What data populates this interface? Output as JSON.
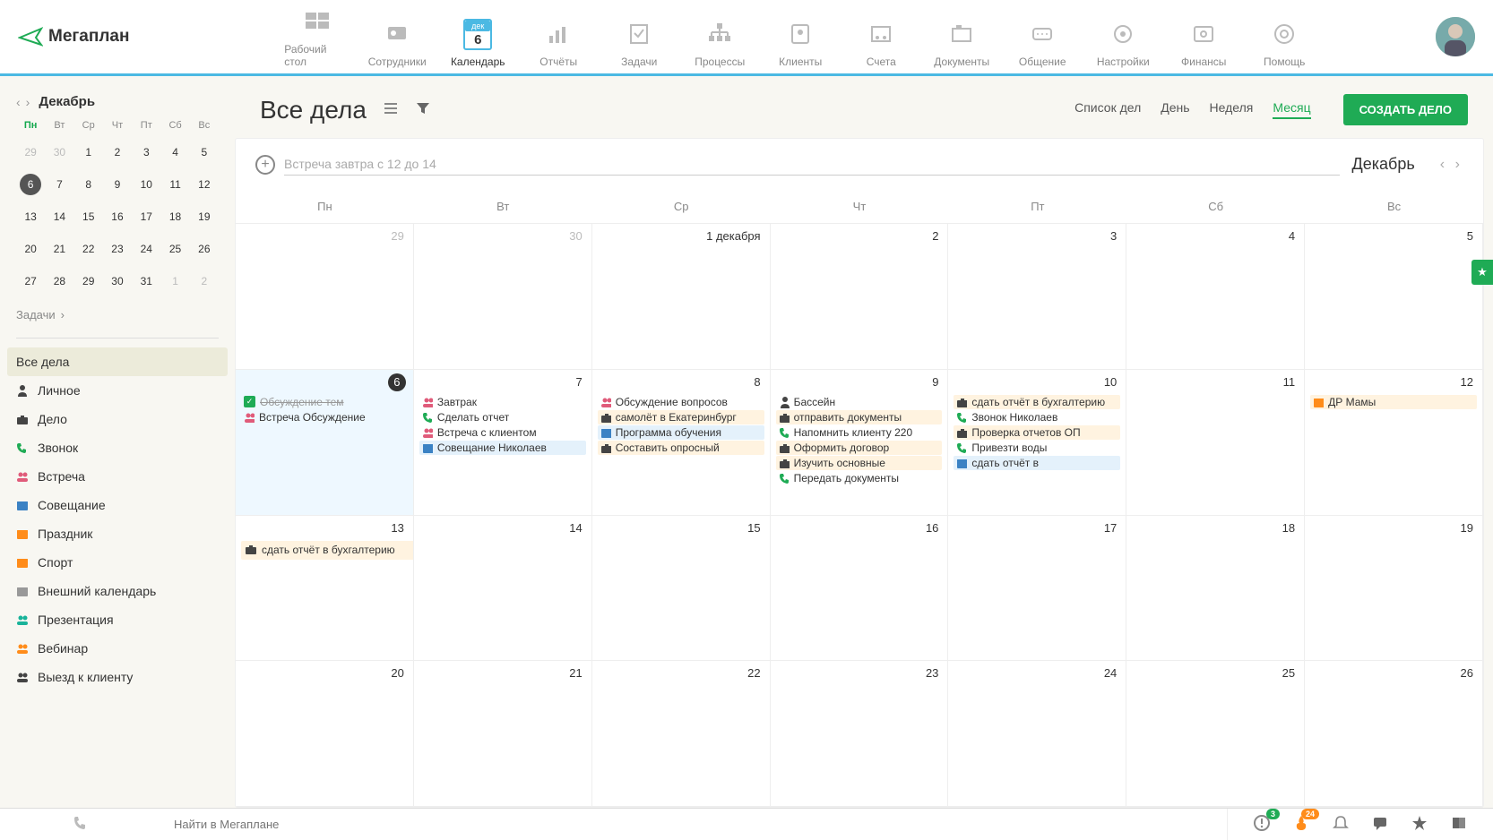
{
  "brand": "егаплан",
  "nav": [
    {
      "label": "Рабочий стол"
    },
    {
      "label": "Сотрудники"
    },
    {
      "label": "Календарь",
      "active": true,
      "badge": "дек",
      "num": "6"
    },
    {
      "label": "Отчёты"
    },
    {
      "label": "Задачи"
    },
    {
      "label": "Процессы"
    },
    {
      "label": "Клиенты"
    },
    {
      "label": "Счета"
    },
    {
      "label": "Документы"
    },
    {
      "label": "Общение"
    },
    {
      "label": "Настройки"
    },
    {
      "label": "Финансы"
    },
    {
      "label": "Помощь"
    }
  ],
  "sidebar": {
    "month": "Декабрь",
    "dow": [
      "Пн",
      "Вт",
      "Ср",
      "Чт",
      "Пт",
      "Сб",
      "Вс"
    ],
    "days": [
      {
        "n": "29",
        "m": true
      },
      {
        "n": "30",
        "m": true
      },
      {
        "n": "1"
      },
      {
        "n": "2"
      },
      {
        "n": "3"
      },
      {
        "n": "4"
      },
      {
        "n": "5"
      },
      {
        "n": "6",
        "sel": true
      },
      {
        "n": "7"
      },
      {
        "n": "8"
      },
      {
        "n": "9"
      },
      {
        "n": "10"
      },
      {
        "n": "11"
      },
      {
        "n": "12"
      },
      {
        "n": "13"
      },
      {
        "n": "14"
      },
      {
        "n": "15"
      },
      {
        "n": "16"
      },
      {
        "n": "17"
      },
      {
        "n": "18"
      },
      {
        "n": "19"
      },
      {
        "n": "20"
      },
      {
        "n": "21"
      },
      {
        "n": "22"
      },
      {
        "n": "23"
      },
      {
        "n": "24"
      },
      {
        "n": "25"
      },
      {
        "n": "26"
      },
      {
        "n": "27"
      },
      {
        "n": "28"
      },
      {
        "n": "29"
      },
      {
        "n": "30"
      },
      {
        "n": "31"
      },
      {
        "n": "1",
        "m": true
      },
      {
        "n": "2",
        "m": true
      }
    ],
    "tasks_label": "Задачи",
    "categories": [
      {
        "label": "Все дела",
        "sel": true
      },
      {
        "label": "Личное",
        "icon": "person",
        "color": "c-dark"
      },
      {
        "label": "Дело",
        "icon": "briefcase",
        "color": "c-dark"
      },
      {
        "label": "Звонок",
        "icon": "phone",
        "color": "c-green"
      },
      {
        "label": "Встреча",
        "icon": "people",
        "color": "c-pink"
      },
      {
        "label": "Совещание",
        "icon": "calendar",
        "color": "c-blue"
      },
      {
        "label": "Праздник",
        "icon": "calendar",
        "color": "c-orange"
      },
      {
        "label": "Спорт",
        "icon": "calendar",
        "color": "c-orange"
      },
      {
        "label": "Внешний календарь",
        "icon": "calendar",
        "color": "c-grey"
      },
      {
        "label": "Презентация",
        "icon": "people",
        "color": "c-teal"
      },
      {
        "label": "Вебинар",
        "icon": "people",
        "color": "c-orange"
      },
      {
        "label": "Выезд к клиенту",
        "icon": "people",
        "color": "c-dark"
      }
    ]
  },
  "toolbar": {
    "title": "Все дела",
    "views": [
      "Список дел",
      "День",
      "Неделя",
      "Месяц"
    ],
    "active_view": 3,
    "create_label": "СОЗДАТЬ ДЕЛО"
  },
  "panel": {
    "quick_placeholder": "Встреча завтра с 12 до 14",
    "month_label": "Декабрь",
    "dow": [
      "Пн",
      "Вт",
      "Ср",
      "Чт",
      "Пт",
      "Сб",
      "Вс"
    ]
  },
  "weeks": [
    [
      {
        "num": "29",
        "muted": true
      },
      {
        "num": "30",
        "muted": true
      },
      {
        "num": "1 декабря",
        "first": true
      },
      {
        "num": "2"
      },
      {
        "num": "3"
      },
      {
        "num": "4"
      },
      {
        "num": "5"
      }
    ],
    [
      {
        "num": "6",
        "today": true,
        "events": [
          {
            "icon": "check",
            "text": "Обсуждение тем",
            "strike": true
          },
          {
            "icon": "people",
            "color": "c-pink",
            "text": "Встреча  Обсуждение"
          }
        ]
      },
      {
        "num": "7",
        "events": [
          {
            "icon": "people",
            "color": "c-pink",
            "text": "Завтрак"
          },
          {
            "icon": "phone",
            "color": "c-green",
            "text": "Сделать отчет"
          },
          {
            "icon": "people",
            "color": "c-pink",
            "text": "Встреча с клиентом"
          },
          {
            "icon": "calendar",
            "color": "c-blue",
            "text": "Совещание  Николаев",
            "bg": "bg-blue"
          }
        ]
      },
      {
        "num": "8",
        "events": [
          {
            "icon": "people",
            "color": "c-pink",
            "text": "Обсуждение вопросов"
          },
          {
            "icon": "briefcase",
            "color": "c-dark",
            "text": "самолёт в Екатеринбург",
            "bg": "bg-orange"
          },
          {
            "icon": "calendar",
            "color": "c-blue",
            "text": "Программа обучения",
            "bg": "bg-blue"
          },
          {
            "icon": "briefcase",
            "color": "c-dark",
            "text": "Составить опросный",
            "bg": "bg-orange"
          }
        ]
      },
      {
        "num": "9",
        "events": [
          {
            "icon": "person",
            "color": "c-dark",
            "text": "Бассейн"
          },
          {
            "icon": "briefcase",
            "color": "c-dark",
            "text": "отправить документы",
            "bg": "bg-orange"
          },
          {
            "icon": "phone",
            "color": "c-green",
            "text": "Напомнить клиенту 220"
          },
          {
            "icon": "briefcase",
            "color": "c-dark",
            "text": "Оформить договор",
            "bg": "bg-orange"
          },
          {
            "icon": "briefcase",
            "color": "c-dark",
            "text": "Изучить основные",
            "bg": "bg-orange"
          },
          {
            "icon": "phone",
            "color": "c-green",
            "text": "Передать документы"
          }
        ]
      },
      {
        "num": "10",
        "events": [
          {
            "icon": "briefcase",
            "color": "c-dark",
            "text": "сдать отчёт в бухгалтерию",
            "bg": "bg-orange"
          },
          {
            "icon": "phone",
            "color": "c-green",
            "text": "Звонок  Николаев"
          },
          {
            "icon": "briefcase",
            "color": "c-dark",
            "text": "Проверка отчетов ОП",
            "bg": "bg-orange"
          },
          {
            "icon": "phone",
            "color": "c-green",
            "text": "Привезти воды"
          },
          {
            "icon": "calendar",
            "color": "c-blue",
            "text": "сдать отчёт в",
            "bg": "bg-blue"
          }
        ]
      },
      {
        "num": "11"
      },
      {
        "num": "12",
        "events": [
          {
            "icon": "calendar",
            "color": "c-orange",
            "text": "ДР Мамы",
            "bg": "bg-orange"
          }
        ]
      }
    ],
    [
      {
        "num": "13",
        "span": {
          "icon": "briefcase",
          "color": "c-dark",
          "text": "сдать отчёт в бухгалтерию"
        }
      },
      {
        "num": "14"
      },
      {
        "num": "15"
      },
      {
        "num": "16"
      },
      {
        "num": "17"
      },
      {
        "num": "18"
      },
      {
        "num": "19"
      }
    ],
    [
      {
        "num": "20"
      },
      {
        "num": "21"
      },
      {
        "num": "22"
      },
      {
        "num": "23"
      },
      {
        "num": "24"
      },
      {
        "num": "25"
      },
      {
        "num": "26"
      }
    ]
  ],
  "footer": {
    "search_placeholder": "Найти в Мегаплане",
    "badge1": "3",
    "badge2": "24"
  }
}
